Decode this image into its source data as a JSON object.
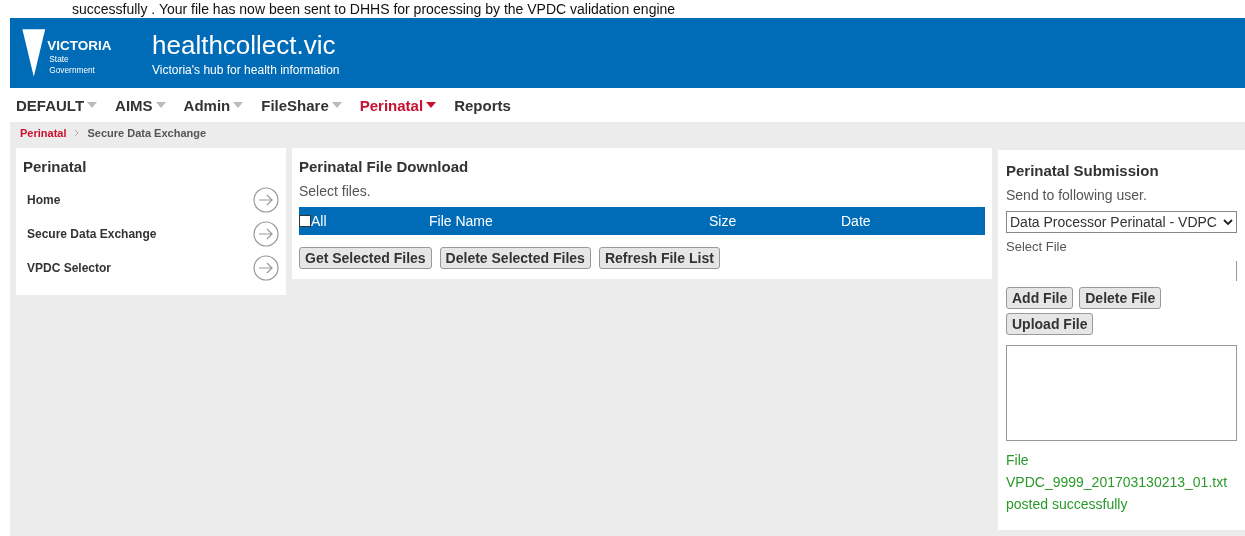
{
  "notice": "successfully . Your file has now been sent to DHHS for processing by the VPDC validation engine",
  "header": {
    "logo_text": "VICTORIA",
    "logo_sub1": "State",
    "logo_sub2": "Government",
    "title": "healthcollect.vic",
    "tagline": "Victoria's hub for health information"
  },
  "nav": [
    {
      "label": "DEFAULT",
      "dropdown": true,
      "selected": false
    },
    {
      "label": "AIMS",
      "dropdown": true,
      "selected": false
    },
    {
      "label": "Admin",
      "dropdown": true,
      "selected": false
    },
    {
      "label": "FileShare",
      "dropdown": true,
      "selected": false
    },
    {
      "label": "Perinatal",
      "dropdown": true,
      "selected": true
    },
    {
      "label": "Reports",
      "dropdown": false,
      "selected": false
    }
  ],
  "breadcrumb": [
    "Perinatal",
    "Secure Data Exchange"
  ],
  "sidebar": {
    "title": "Perinatal",
    "items": [
      "Home",
      "Secure Data Exchange",
      "VPDC Selector"
    ]
  },
  "download": {
    "title": "Perinatal File Download",
    "hint": "Select files.",
    "columns": [
      "All",
      "File Name",
      "Size",
      "Date"
    ],
    "all_checked": false,
    "buttons": [
      "Get Selected Files",
      "Delete Selected Files",
      "Refresh File List"
    ]
  },
  "submission": {
    "title": "Perinatal Submission",
    "user_label": "Send to following user.",
    "user_value": "Data Processor Perinatal - VDPC",
    "file_label": "Select File",
    "file_buttons": [
      "Add File",
      "Delete File"
    ],
    "upload_button": "Upload File",
    "status_lines": [
      "File",
      "VPDC_9999_201703130213_01.txt",
      "posted successfully"
    ]
  }
}
